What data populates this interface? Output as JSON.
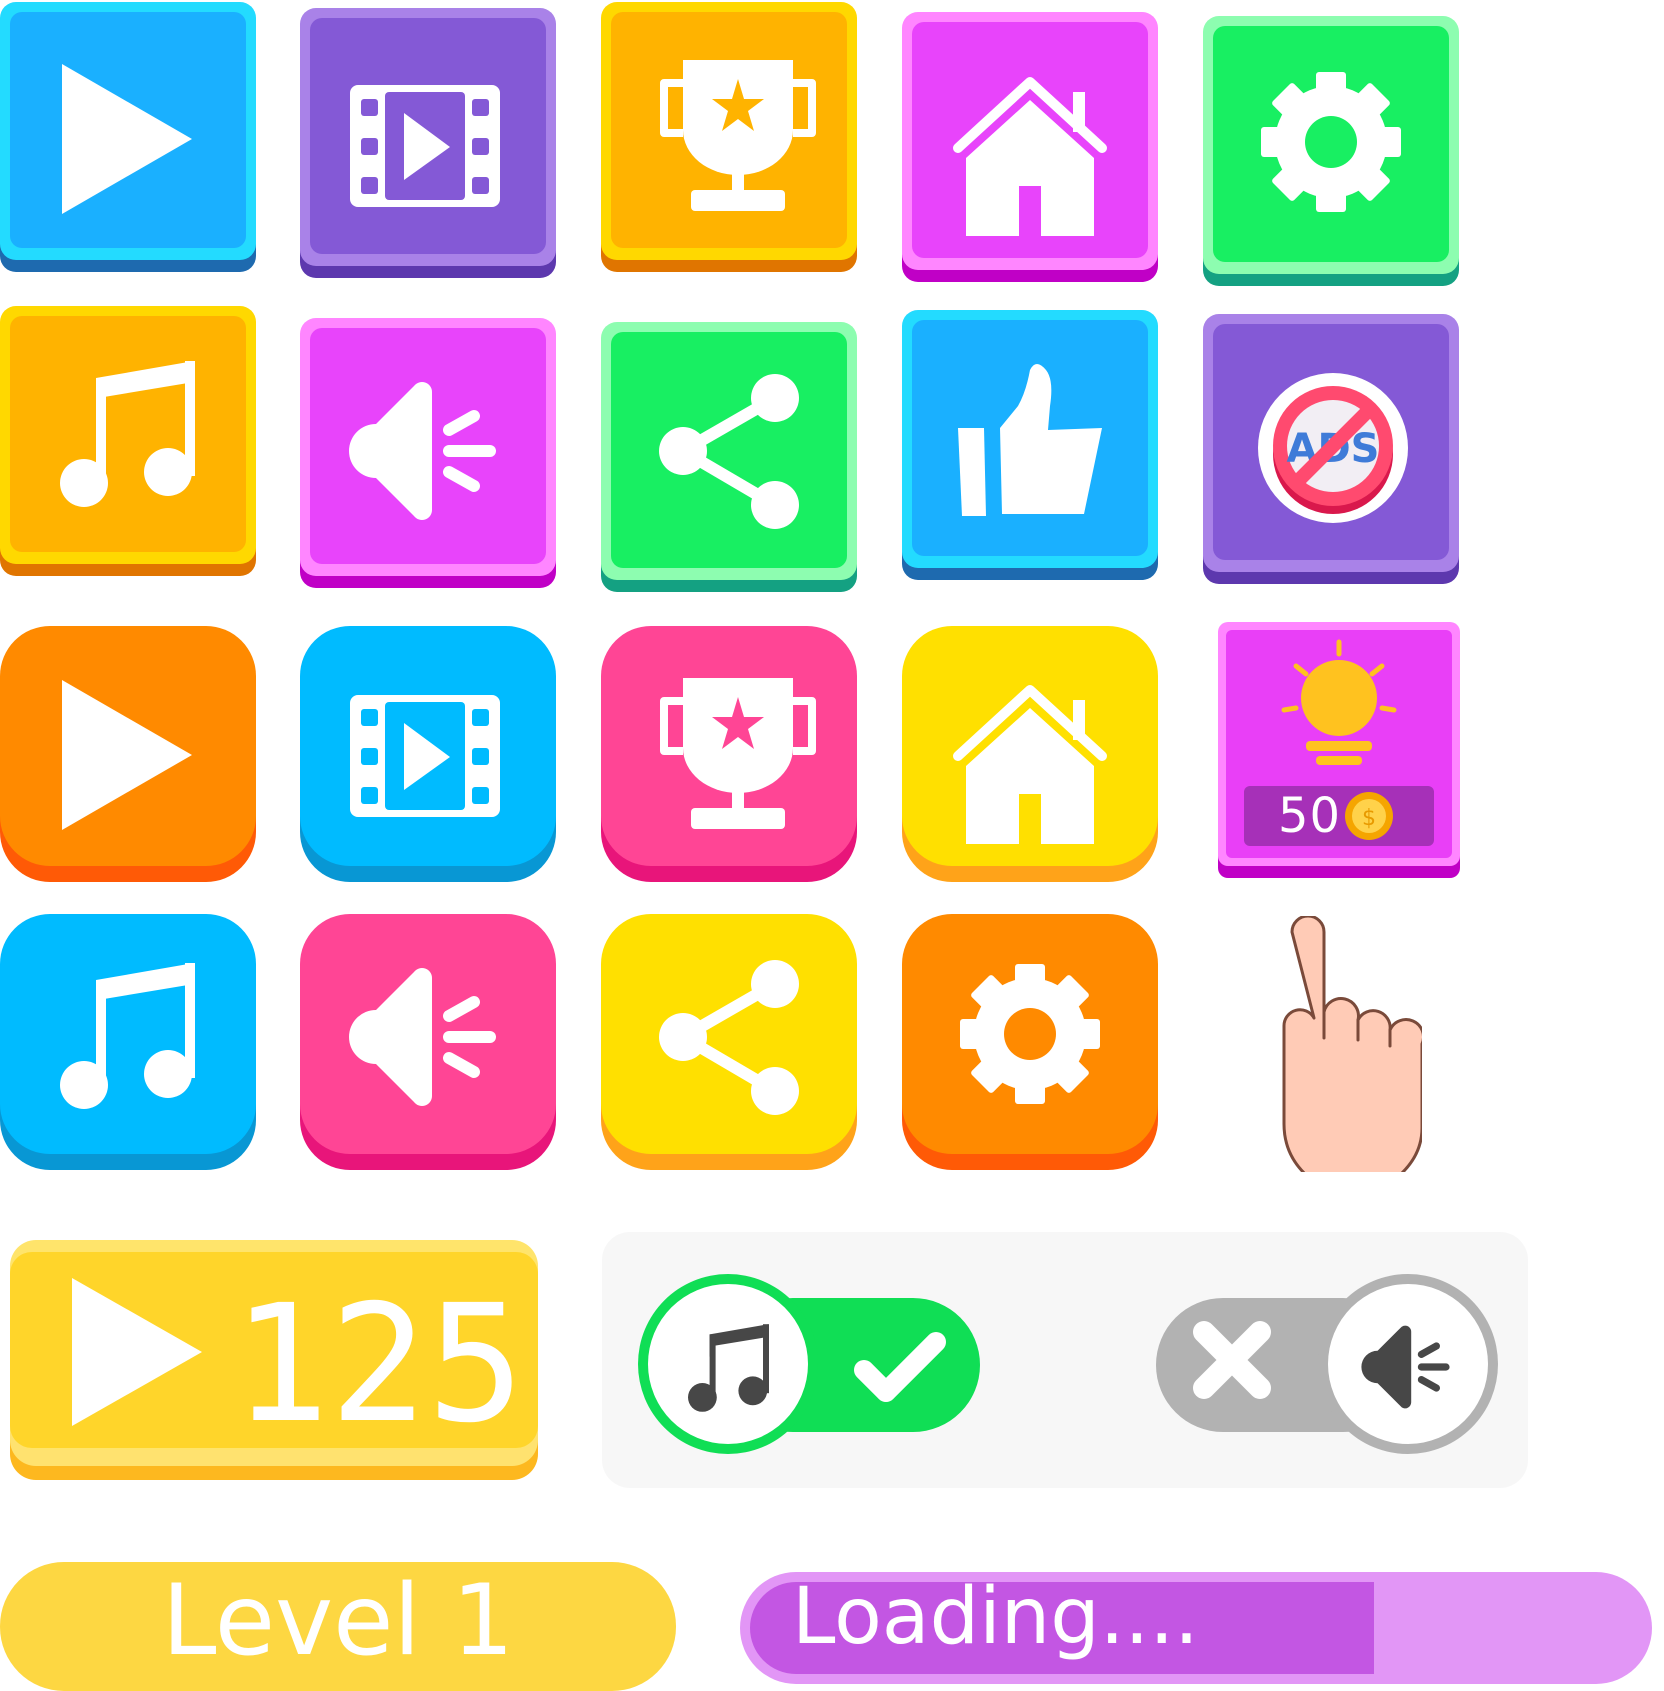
{
  "icons": {
    "row1": [
      "play-icon",
      "video-icon",
      "trophy-icon",
      "home-icon",
      "gear-icon"
    ],
    "row2": [
      "music-icon",
      "sound-icon",
      "share-icon",
      "thumbs-up-icon",
      "no-ads-icon"
    ],
    "row3": [
      "play-icon",
      "video-icon",
      "trophy-icon",
      "home-icon",
      "lightbulb-icon"
    ],
    "row4": [
      "music-icon",
      "sound-icon",
      "share-icon",
      "gear-icon",
      "pointing-hand-icon"
    ]
  },
  "colors": {
    "blue": "#1ab0ff",
    "purple": "#8459d6",
    "amber": "#ffb300",
    "magenta": "#e844fb",
    "green": "#18ef62",
    "orange": "#ff8a00",
    "cyan": "#00bbff",
    "pink": "#ff4595",
    "yellow": "#ffe000",
    "hint_pink": "#e93ff7",
    "hint_coin": "#ffc21f"
  },
  "no_ads": {
    "text": "ADS"
  },
  "hint": {
    "cost": "50",
    "currency_symbol": "$"
  },
  "reward": {
    "count": "125"
  },
  "toggles": {
    "music": {
      "state": "on",
      "icon": "music-icon",
      "status_icon": "check-icon"
    },
    "sound": {
      "state": "off",
      "icon": "sound-icon",
      "status_icon": "close-icon"
    }
  },
  "level": {
    "label": "Level 1"
  },
  "loading": {
    "label": "Loading....",
    "progress": 0.7
  }
}
